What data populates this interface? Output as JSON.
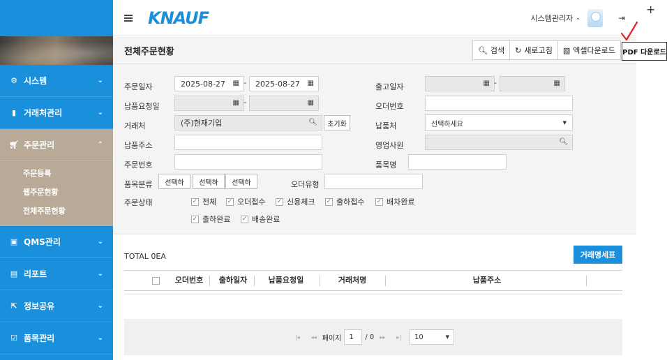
{
  "sidebar": {
    "items": [
      {
        "label": "시스템",
        "icon": "gear-icon"
      },
      {
        "label": "거래처관리",
        "icon": "bookmark-icon"
      },
      {
        "label": "주문관리",
        "icon": "cart-icon"
      },
      {
        "label": "QMS관리",
        "icon": "info-icon"
      },
      {
        "label": "리포트",
        "icon": "file-icon"
      },
      {
        "label": "정보공유",
        "icon": "share-icon"
      },
      {
        "label": "품목관리",
        "icon": "checkbox-icon"
      }
    ],
    "sub_items": [
      "주문등록",
      "웹주문현황",
      "전체주문현황"
    ]
  },
  "header": {
    "logo": "KNAUF",
    "user": "시스템관리자"
  },
  "page": {
    "title": "전체주문현황",
    "actions": [
      "검색",
      "새로고침",
      "엑셀다운로드"
    ],
    "pdf_label": "PDF 다운로드"
  },
  "form": {
    "order_date_label": "주문일자",
    "order_date_from": "2025-08-27",
    "order_date_to": "2025-08-27",
    "ship_date_label": "출고일자",
    "due_date_label": "납품요청일",
    "order_no_label": "오더번호",
    "customer_label": "거래처",
    "customer_value": "(주)현재기업",
    "reset_label": "초기화",
    "delivery_place_label": "납품처",
    "delivery_place_placeholder": "선택하세요",
    "address_label": "납품주소",
    "sales_label": "영업사원",
    "order_number_label": "주문번호",
    "item_name_label": "품목명",
    "item_class_label": "품목분류",
    "item_class_selects": [
      "선택하",
      "선택하",
      "선택하"
    ],
    "order_type_label": "오더유형",
    "status_label": "주문상태",
    "status_options": [
      "전체",
      "오더접수",
      "신용체크",
      "출하접수",
      "배차완료",
      "출하완료",
      "배송완료"
    ]
  },
  "results": {
    "total": "TOTAL 0EA",
    "statement_button": "거래명세표",
    "columns": [
      "오더번호",
      "출하일자",
      "납품요청일",
      "거래처명",
      "납품주소"
    ]
  },
  "pager": {
    "page_label": "페이지",
    "page": "1",
    "total_pages": "/ 0",
    "page_size": "10"
  }
}
